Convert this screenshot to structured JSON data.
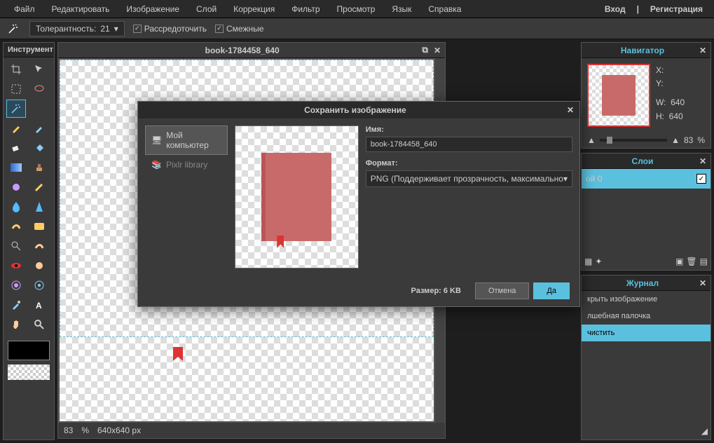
{
  "menubar": {
    "items": [
      "Файл",
      "Редактировать",
      "Изображение",
      "Слой",
      "Коррекция",
      "Фильтр",
      "Просмотр",
      "Язык",
      "Справка"
    ],
    "login": "Вход",
    "sep": "|",
    "register": "Регистрация"
  },
  "optbar": {
    "tolerance_label": "Толерантность:",
    "tolerance_value": "21",
    "scatter": "Рассредоточить",
    "contiguous": "Смежные"
  },
  "toolpanel": {
    "title": "Инструмент"
  },
  "document": {
    "title": "book-1784458_640",
    "zoom": "83",
    "zoom_pct": "%",
    "dims": "640x640 px"
  },
  "navigator": {
    "title": "Навигатор",
    "x_label": "X:",
    "y_label": "Y:",
    "w_label": "W:",
    "h_label": "H:",
    "w_val": "640",
    "h_val": "640",
    "zoom": "83",
    "pct": "%"
  },
  "layers": {
    "title": "Слои",
    "layer0": "ой 0"
  },
  "history": {
    "title": "Журнал",
    "items": [
      "крыть изображение",
      "лшебная палочка",
      "чистить"
    ]
  },
  "dialog": {
    "title": "Сохранить изображение",
    "tab_computer": "Мой компьютер",
    "tab_library": "Pixlr library",
    "name_label": "Имя:",
    "name_value": "book-1784458_640",
    "format_label": "Формат:",
    "format_value": "PNG (Поддерживает прозрачность, максимально",
    "size": "Размер: 6 KB",
    "cancel": "Отмена",
    "ok": "Да"
  }
}
